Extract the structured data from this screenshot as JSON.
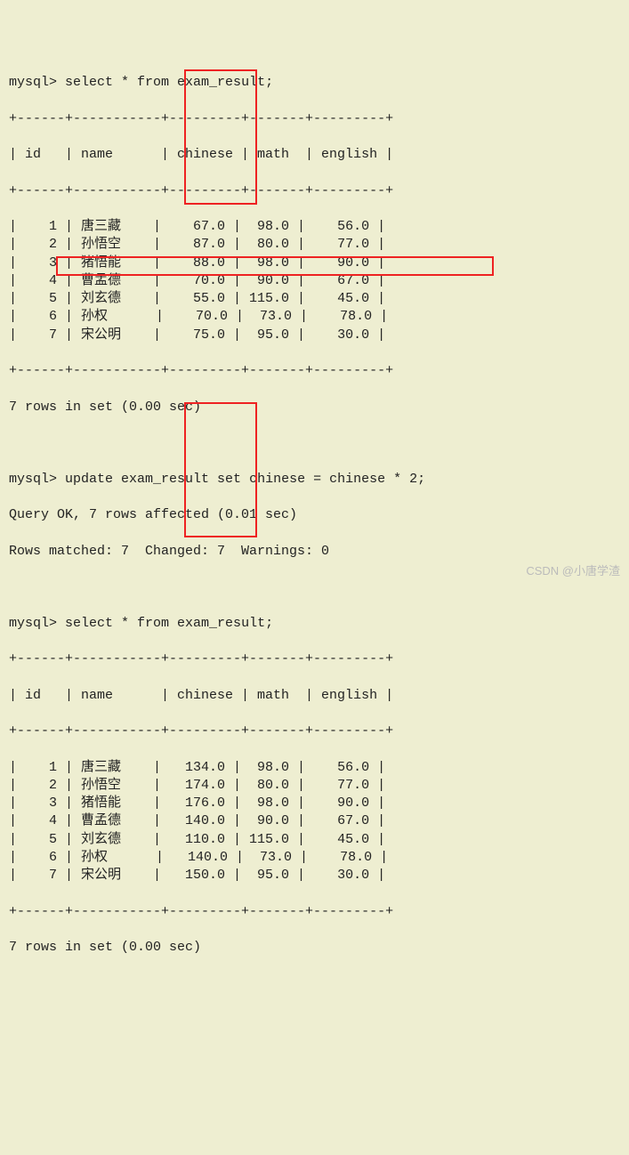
{
  "prompt": "mysql>",
  "query1": "select * from exam_result;",
  "update_cmd": "update exam_result set chinese = chinese * 2;",
  "query2": "select * from exam_result;",
  "cols": {
    "id": "id",
    "name": "name",
    "chinese": "chinese",
    "math": "math",
    "english": "english"
  },
  "sep": "+------+-----------+---------+-------+---------+",
  "hdr": "| id   | name      | chinese | math  | english |",
  "t1": {
    "rows": [
      {
        "id": "1",
        "name": "唐三藏",
        "chinese": "67.0",
        "math": "98.0",
        "english": "56.0"
      },
      {
        "id": "2",
        "name": "孙悟空",
        "chinese": "87.0",
        "math": "80.0",
        "english": "77.0"
      },
      {
        "id": "3",
        "name": "猪悟能",
        "chinese": "88.0",
        "math": "98.0",
        "english": "90.0"
      },
      {
        "id": "4",
        "name": "曹孟德",
        "chinese": "70.0",
        "math": "90.0",
        "english": "67.0"
      },
      {
        "id": "5",
        "name": "刘玄德",
        "chinese": "55.0",
        "math": "115.0",
        "english": "45.0"
      },
      {
        "id": "6",
        "name": "孙权",
        "chinese": "70.0",
        "math": "73.0",
        "english": "78.0"
      },
      {
        "id": "7",
        "name": "宋公明",
        "chinese": "75.0",
        "math": "95.0",
        "english": "30.0"
      }
    ]
  },
  "rows_msg1": "7 rows in set (0.00 sec)",
  "update_ok": "Query OK, 7 rows affected (0.01 sec)",
  "rows_matched": "Rows matched: 7  Changed: 7  Warnings: 0",
  "t2": {
    "rows": [
      {
        "id": "1",
        "name": "唐三藏",
        "chinese": "134.0",
        "math": "98.0",
        "english": "56.0"
      },
      {
        "id": "2",
        "name": "孙悟空",
        "chinese": "174.0",
        "math": "80.0",
        "english": "77.0"
      },
      {
        "id": "3",
        "name": "猪悟能",
        "chinese": "176.0",
        "math": "98.0",
        "english": "90.0"
      },
      {
        "id": "4",
        "name": "曹孟德",
        "chinese": "140.0",
        "math": "90.0",
        "english": "67.0"
      },
      {
        "id": "5",
        "name": "刘玄德",
        "chinese": "110.0",
        "math": "115.0",
        "english": "45.0"
      },
      {
        "id": "6",
        "name": "孙权",
        "chinese": "140.0",
        "math": "73.0",
        "english": "78.0"
      },
      {
        "id": "7",
        "name": "宋公明",
        "chinese": "150.0",
        "math": "95.0",
        "english": "30.0"
      }
    ]
  },
  "rows_msg2": "7 rows in set (0.00 sec)",
  "watermark": "CSDN @小唐学渣"
}
